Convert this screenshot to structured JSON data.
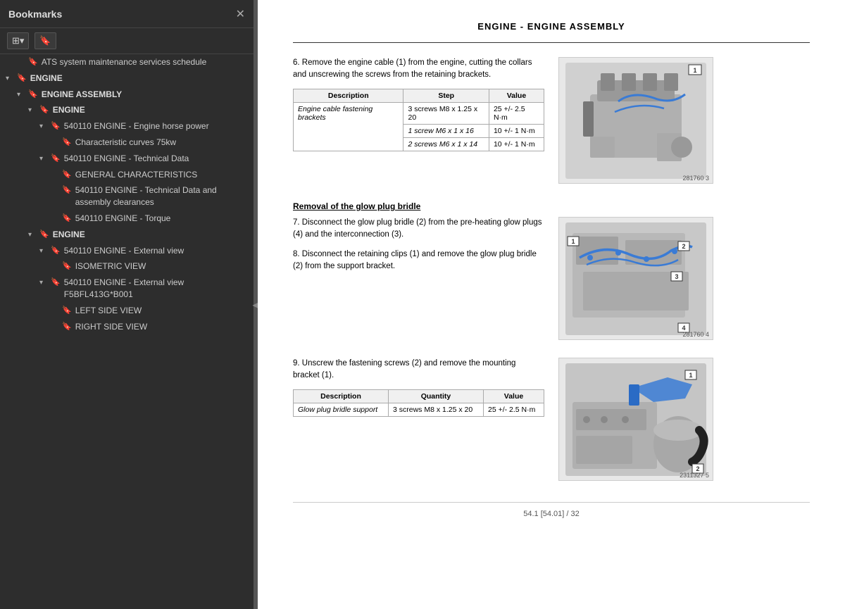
{
  "sidebar": {
    "title": "Bookmarks",
    "toolbar": {
      "grid_icon": "⊞",
      "bookmark_icon": "🔖"
    },
    "items": [
      {
        "id": "ats",
        "label": "ATS system maintenance services schedule",
        "indent": 1,
        "hasArrow": false,
        "bold": false
      },
      {
        "id": "engine",
        "label": "ENGINE",
        "indent": 0,
        "hasArrow": true,
        "expanded": true,
        "bold": true
      },
      {
        "id": "engine-assembly",
        "label": "ENGINE ASSEMBLY",
        "indent": 1,
        "hasArrow": true,
        "expanded": true,
        "bold": true
      },
      {
        "id": "engine-sub",
        "label": "ENGINE",
        "indent": 2,
        "hasArrow": true,
        "expanded": true,
        "bold": true
      },
      {
        "id": "540110-horse",
        "label": "540110  ENGINE - Engine horse power",
        "indent": 3,
        "hasArrow": true,
        "expanded": true,
        "bold": false
      },
      {
        "id": "char-curves",
        "label": "Characteristic curves 75kw",
        "indent": 4,
        "hasArrow": false,
        "bold": false
      },
      {
        "id": "540110-tech",
        "label": "540110  ENGINE - Technical Data",
        "indent": 3,
        "hasArrow": true,
        "expanded": true,
        "bold": false
      },
      {
        "id": "gen-char",
        "label": "GENERAL CHARACTERISTICS",
        "indent": 4,
        "hasArrow": false,
        "bold": false
      },
      {
        "id": "540110-techdata",
        "label": "540110  ENGINE - Technical Data and assembly clearances",
        "indent": 4,
        "hasArrow": false,
        "bold": false
      },
      {
        "id": "540110-torque",
        "label": "540110  ENGINE - Torque",
        "indent": 4,
        "hasArrow": false,
        "bold": false
      },
      {
        "id": "engine2",
        "label": "ENGINE",
        "indent": 2,
        "hasArrow": true,
        "expanded": true,
        "bold": true
      },
      {
        "id": "540110-ext",
        "label": "540110  ENGINE - External view",
        "indent": 3,
        "hasArrow": true,
        "expanded": true,
        "bold": false
      },
      {
        "id": "iso-view",
        "label": "ISOMETRIC VIEW",
        "indent": 4,
        "hasArrow": false,
        "bold": false
      },
      {
        "id": "540110-extf5",
        "label": "540110  ENGINE - External view F5BFL413G*B001",
        "indent": 3,
        "hasArrow": true,
        "expanded": true,
        "bold": false
      },
      {
        "id": "left-view",
        "label": "LEFT SIDE VIEW",
        "indent": 4,
        "hasArrow": false,
        "bold": false
      },
      {
        "id": "right-view",
        "label": "RIGHT SIDE VIEW",
        "indent": 4,
        "hasArrow": false,
        "bold": false
      }
    ]
  },
  "main": {
    "page_title": "ENGINE - ENGINE ASSEMBLY",
    "step6": {
      "number": "6.",
      "text": "Remove the engine cable (1) from the engine, cutting the collars and unscrewing the screws from the retaining brackets."
    },
    "table1": {
      "headers": [
        "Description",
        "Step",
        "Value"
      ],
      "rows": [
        {
          "desc": "Engine cable fastening brackets",
          "steps": [
            {
              "step": "3 screws M8 x 1.25 x 20",
              "value": "25 +/- 2.5 N·m"
            },
            {
              "step": "1 screw M6 x 1 x 16",
              "value": "10 +/- 1 N·m"
            },
            {
              "step": "2 screws M6 x 1 x 14",
              "value": "10 +/- 1 N·m"
            }
          ]
        }
      ]
    },
    "img1_caption": "281760  3",
    "glow_plug_heading": "Removal of the glow plug bridle",
    "step7": {
      "number": "7.",
      "text": "Disconnect the glow plug bridle (2) from the pre-heating glow plugs (4) and the interconnection (3)."
    },
    "step8": {
      "number": "8.",
      "text": "Disconnect the retaining clips (1) and remove the glow plug bridle (2) from the support bracket."
    },
    "img2_caption": "281760  4",
    "step9": {
      "number": "9.",
      "text": "Unscrew the fastening screws (2) and remove the mounting bracket (1)."
    },
    "table2": {
      "headers": [
        "Description",
        "Quantity",
        "Value"
      ],
      "rows": [
        {
          "desc": "Glow plug bridle support",
          "qty": "3 screws M8 x 1.25 x 20",
          "value": "25 +/- 2.5 N·m"
        }
      ]
    },
    "img3_caption": "2311327  5",
    "footer": "54.1 [54.01] / 32"
  }
}
